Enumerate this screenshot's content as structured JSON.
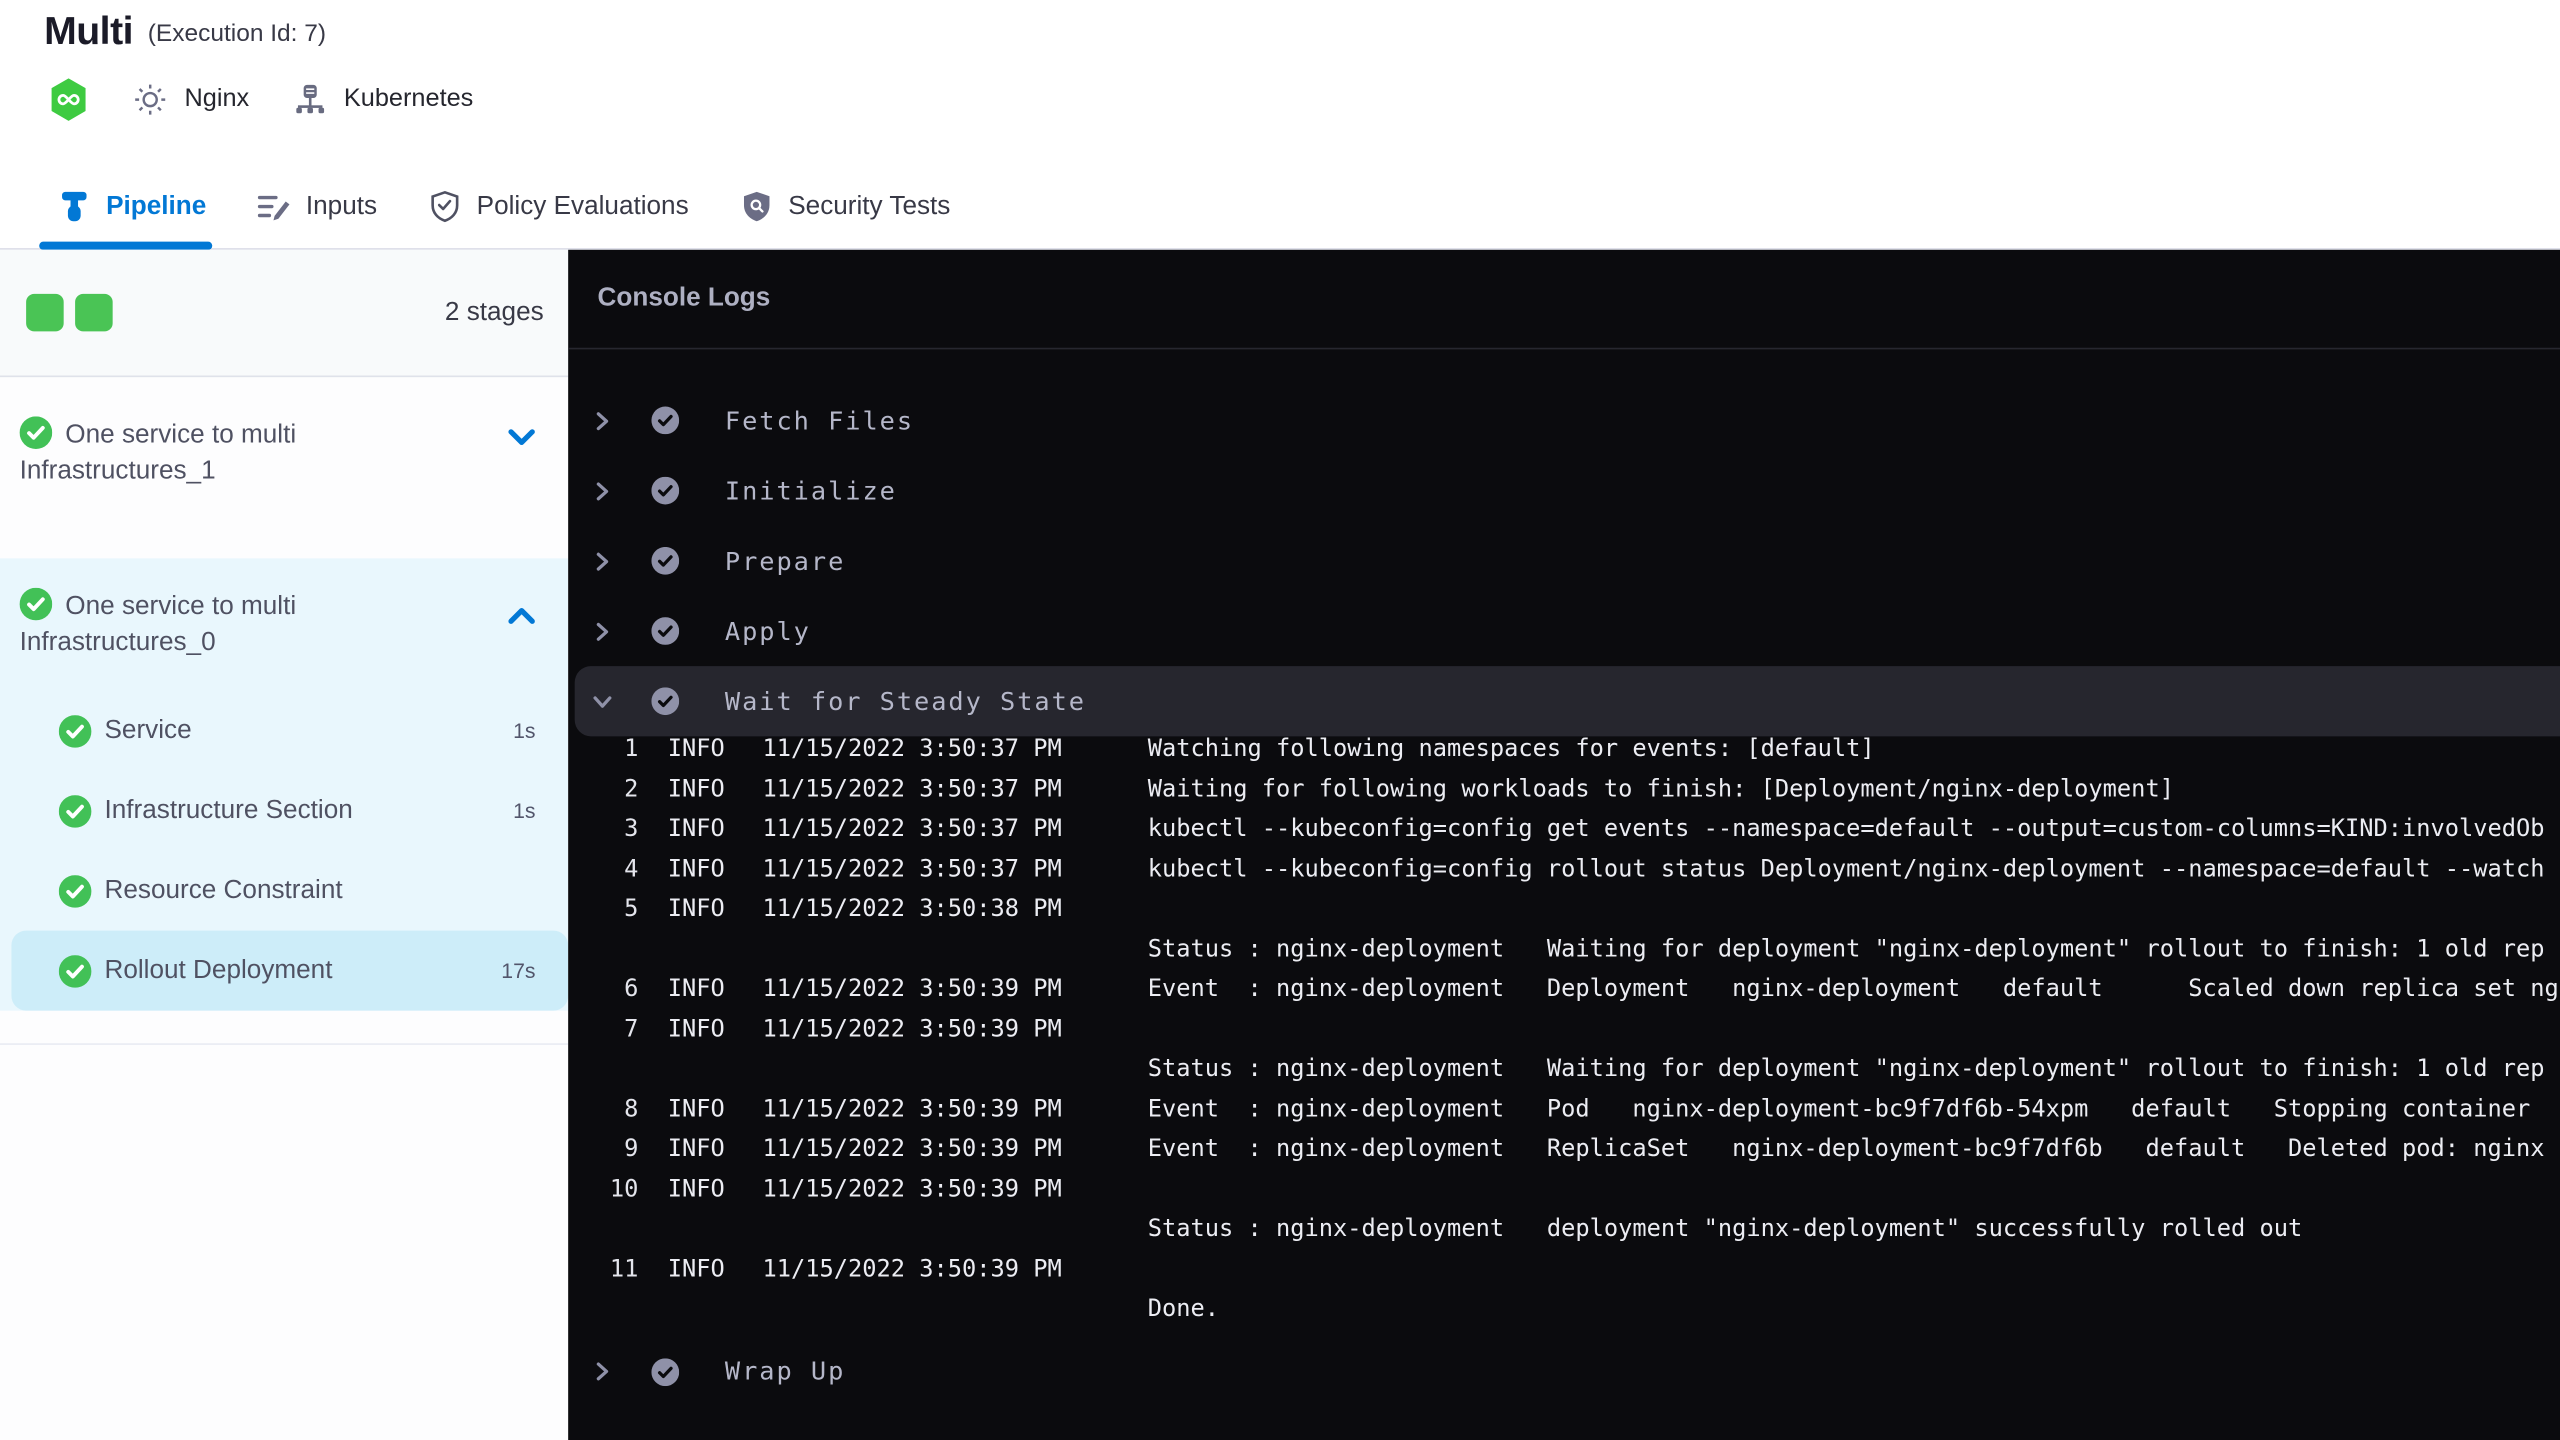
{
  "colors": {
    "accent_blue": "#0278d5",
    "success_green": "#4ac455",
    "sidebar_group_bg": "#e9f7fd",
    "selected_step_bg": "#cdedf9",
    "console_bg": "#0b0b0e",
    "console_highlight_bg": "#26262e",
    "console_text": "#ecedf3"
  },
  "header": {
    "title": "Multi",
    "execution_id": "(Execution Id: 7)",
    "service_icon": "hexagon-infinity-icon",
    "service_config_icon": "gear-icon",
    "service_name": "Nginx",
    "infrastructure_icon": "infrastructure-icon",
    "infrastructure_name": "Kubernetes"
  },
  "tabs": [
    {
      "label": "Pipeline",
      "icon": "pipeline-icon",
      "active": true
    },
    {
      "label": "Inputs",
      "icon": "inputs-edit-icon",
      "active": false
    },
    {
      "label": "Policy Evaluations",
      "icon": "shield-check-icon",
      "active": false
    },
    {
      "label": "Security Tests",
      "icon": "shield-search-icon",
      "active": false
    }
  ],
  "sidebar": {
    "stages_count": "2 stages",
    "stages": [
      {
        "name": "One service to multi Infrastructures_1",
        "status": "success",
        "expanded": false,
        "steps": []
      },
      {
        "name": "One service to multi Infrastructures_0",
        "status": "success",
        "expanded": true,
        "steps": [
          {
            "label": "Service",
            "duration": "1s",
            "status": "success",
            "selected": false
          },
          {
            "label": "Infrastructure Section",
            "duration": "1s",
            "status": "success",
            "selected": false
          },
          {
            "label": "Resource Constraint",
            "duration": "",
            "status": "success",
            "selected": false
          },
          {
            "label": "Rollout Deployment",
            "duration": "17s",
            "status": "success",
            "selected": true
          }
        ]
      }
    ]
  },
  "console": {
    "title": "Console Logs",
    "sections": [
      {
        "label": "Fetch Files",
        "status": "success",
        "expanded": false,
        "logs": []
      },
      {
        "label": "Initialize",
        "status": "success",
        "expanded": false,
        "logs": []
      },
      {
        "label": "Prepare",
        "status": "success",
        "expanded": false,
        "logs": []
      },
      {
        "label": "Apply",
        "status": "success",
        "expanded": false,
        "logs": []
      },
      {
        "label": "Wait for Steady State",
        "status": "success",
        "expanded": true,
        "highlighted": true,
        "logs": [
          {
            "num": "1",
            "level": "INFO",
            "time": "11/15/2022 3:50:37 PM",
            "msg": "Watching following namespaces for events: [default]"
          },
          {
            "num": "2",
            "level": "INFO",
            "time": "11/15/2022 3:50:37 PM",
            "msg": "Waiting for following workloads to finish: [Deployment/nginx-deployment]"
          },
          {
            "num": "3",
            "level": "INFO",
            "time": "11/15/2022 3:50:37 PM",
            "msg": "kubectl --kubeconfig=config get events --namespace=default --output=custom-columns=KIND:involvedOb"
          },
          {
            "num": "4",
            "level": "INFO",
            "time": "11/15/2022 3:50:37 PM",
            "msg": "kubectl --kubeconfig=config rollout status Deployment/nginx-deployment --namespace=default --watch"
          },
          {
            "num": "5",
            "level": "INFO",
            "time": "11/15/2022 3:50:38 PM",
            "msg": ""
          },
          {
            "num": "",
            "level": "",
            "time": "",
            "msg": "Status : nginx-deployment   Waiting for deployment \"nginx-deployment\" rollout to finish: 1 old rep"
          },
          {
            "num": "6",
            "level": "INFO",
            "time": "11/15/2022 3:50:39 PM",
            "msg": "Event  : nginx-deployment   Deployment   nginx-deployment   default      Scaled down replica set ng"
          },
          {
            "num": "7",
            "level": "INFO",
            "time": "11/15/2022 3:50:39 PM",
            "msg": ""
          },
          {
            "num": "",
            "level": "",
            "time": "",
            "msg": "Status : nginx-deployment   Waiting for deployment \"nginx-deployment\" rollout to finish: 1 old rep"
          },
          {
            "num": "8",
            "level": "INFO",
            "time": "11/15/2022 3:50:39 PM",
            "msg": "Event  : nginx-deployment   Pod   nginx-deployment-bc9f7df6b-54xpm   default   Stopping container"
          },
          {
            "num": "9",
            "level": "INFO",
            "time": "11/15/2022 3:50:39 PM",
            "msg": "Event  : nginx-deployment   ReplicaSet   nginx-deployment-bc9f7df6b   default   Deleted pod: nginx"
          },
          {
            "num": "10",
            "level": "INFO",
            "time": "11/15/2022 3:50:39 PM",
            "msg": ""
          },
          {
            "num": "",
            "level": "",
            "time": "",
            "msg": "Status : nginx-deployment   deployment \"nginx-deployment\" successfully rolled out"
          },
          {
            "num": "11",
            "level": "INFO",
            "time": "11/15/2022 3:50:39 PM",
            "msg": ""
          },
          {
            "num": "",
            "level": "",
            "time": "",
            "msg": "Done."
          }
        ]
      },
      {
        "label": "Wrap Up",
        "status": "success",
        "expanded": false,
        "logs": []
      }
    ]
  }
}
